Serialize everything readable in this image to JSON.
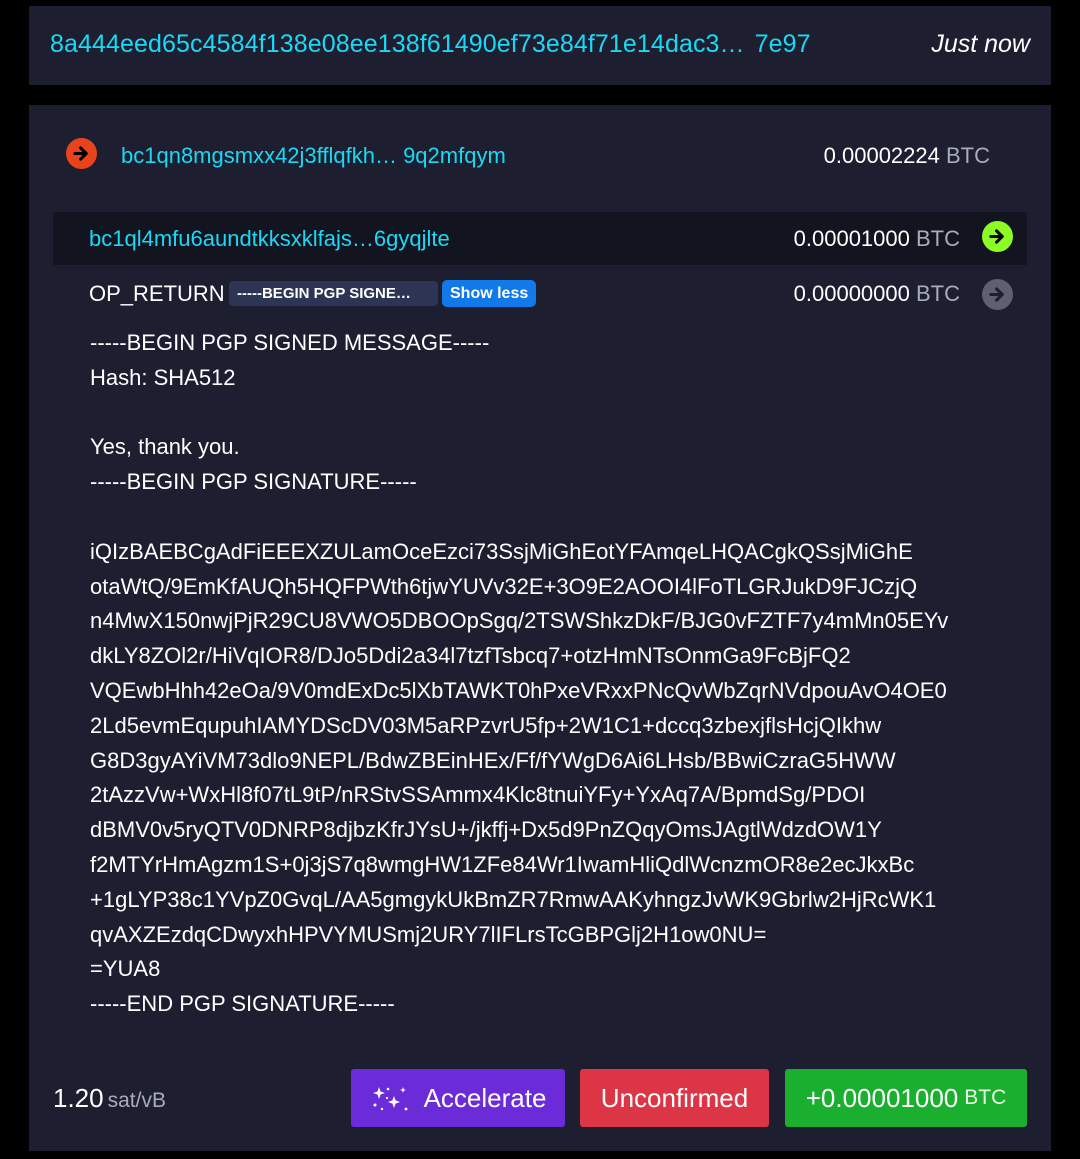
{
  "header": {
    "txid_start": "8a444eed65c4584f138e08ee138f61490ef73e84f71e14dac3…",
    "txid_end": "7e97",
    "timestamp": "Just now"
  },
  "input": {
    "address": "bc1qn8mgsmxx42j3fflqfkh… 9q2mfqym",
    "amount": "0.00002224",
    "unit": "BTC",
    "icon": "arrow-right-circle-icon",
    "icon_color": "#e9431c"
  },
  "output": {
    "address": "bc1ql4mfu6aundtkksxklfajs…6gyqjlte",
    "amount": "0.00001000",
    "unit": "BTC",
    "icon": "arrow-right-circle-icon",
    "icon_color": "#8dfc24"
  },
  "op_return": {
    "label": "OP_RETURN",
    "badge": "-----BEGIN PGP SIGNE…",
    "toggle_label": "Show less",
    "amount": "0.00000000",
    "unit": "BTC",
    "icon": "arrow-right-circle-icon",
    "icon_color": "#5e6070",
    "message_lines": [
      "-----BEGIN PGP SIGNED MESSAGE-----",
      "Hash: SHA512",
      "",
      "Yes, thank you.",
      "-----BEGIN PGP SIGNATURE-----",
      "",
      "iQIzBAEBCgAdFiEEEXZULamOceEzci73SsjMiGhEotYFAmqeLHQACgkQSsjMiGhE",
      "otaWtQ/9EmKfAUQh5HQFPWth6tjwYUVv32E+3O9E2AOOI4lFoTLGRJukD9FJCzjQ",
      "n4MwX150nwjPjR29CU8VWO5DBOOpSgq/2TSWShkzDkF/BJG0vFZTF7y4mMn05EYv",
      "dkLY8ZOl2r/HiVqIOR8/DJo5Ddi2a34l7tzfTsbcq7+otzHmNTsOnmGa9FcBjFQ2",
      "VQEwbHhh42eOa/9V0mdExDc5lXbTAWKT0hPxeVRxxPNcQvWbZqrNVdpouAvO4OE0",
      "2Ld5evmEqupuhIAMYDScDV03M5aRPzvrU5fp+2W1C1+dccq3zbexjflsHcjQIkhw",
      "G8D3gyAYiVM73dlo9NEPL/BdwZBEinHEx/Ff/fYWgD6Ai6LHsb/BBwiCzraG5HWW",
      "2tAzzVw+WxHl8f07tL9tP/nRStvSSAmmx4Klc8tnuiYFy+YxAq7A/BpmdSg/PDOI",
      "dBMV0v5ryQTV0DNRP8djbzKfrJYsU+/jkffj+Dx5d9PnZQqyOmsJAgtlWdzdOW1Y",
      "f2MTYrHmAgzm1S+0j3jS7q8wmgHW1ZFe84Wr1IwamHliQdlWcnzmOR8e2ecJkxBc",
      "+1gLYP38c1YVpZ0GvqL/AA5gmgykUkBmZR7RmwAAKyhngzJvWK9Gbrlw2HjRcWK1",
      "qvAXZEzdqCDwyxhHPVYMUSmj2URY7lIFLrsTcGBPGlj2H1ow0NU=",
      "=YUA8",
      "-----END PGP SIGNATURE-----"
    ]
  },
  "footer": {
    "fee_value": "1.20",
    "fee_unit": "sat/vB",
    "accelerate_label": "Accelerate",
    "accelerate_icon": "sparkles-icon",
    "status_label": "Unconfirmed",
    "value": "+0.00001000",
    "value_unit": "BTC"
  },
  "colors": {
    "accent_cyan": "#1bd8f4",
    "card_bg": "#1d1f31",
    "accelerate": "#6c2bd8",
    "unconfirmed": "#dc3545",
    "positive": "#1aaf2e"
  }
}
